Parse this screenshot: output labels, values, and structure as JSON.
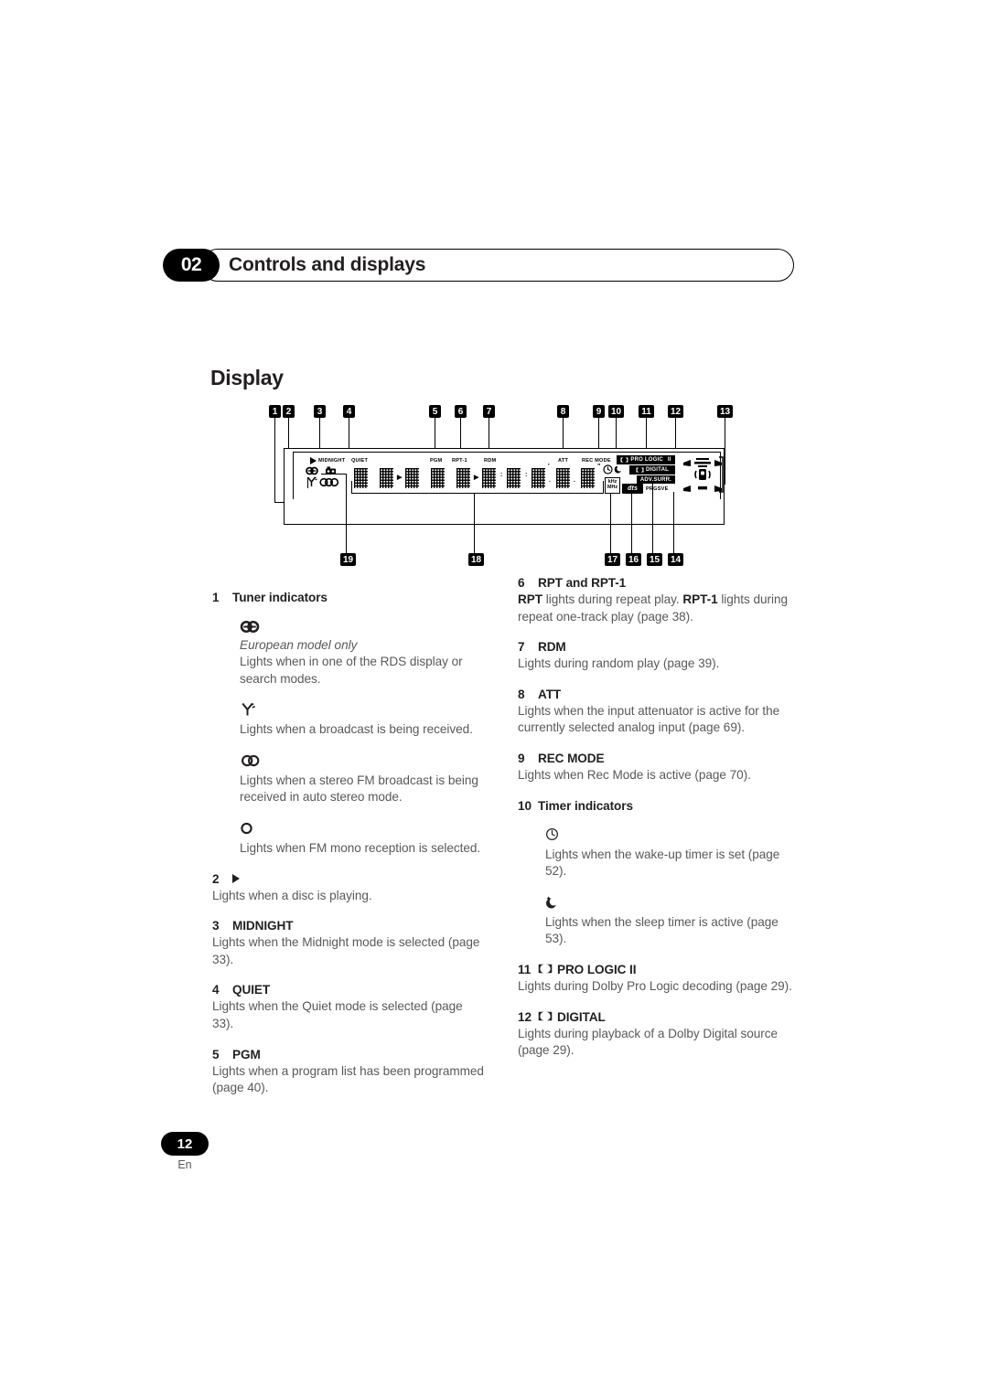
{
  "header": {
    "chapter_number": "02",
    "chapter_title": "Controls and displays"
  },
  "section": {
    "title": "Display"
  },
  "figure": {
    "callouts_top": [
      "1",
      "2",
      "3",
      "4",
      "5",
      "6",
      "7",
      "8",
      "9",
      "10",
      "11",
      "12",
      "13"
    ],
    "callouts_bottom": [
      "19",
      "18",
      "17",
      "16",
      "15",
      "14"
    ],
    "display_labels": {
      "midnight": "MIDNIGHT",
      "quiet": "QUIET",
      "pgm": "PGM",
      "rpt1": "RPT-1",
      "rdm": "RDM",
      "att": "ATT",
      "rec_mode": "REC MODE",
      "pro_logic": "PRO LOGIC",
      "pro_logic_suffix": "II",
      "digital": "DIGITAL",
      "adv_surr": "ADV.SURR.",
      "prgsve": "PRGSVE",
      "khz": "kHz",
      "mhz": "MHz",
      "dts": "dts"
    },
    "icons": [
      "play-triangle-icon",
      "rds-icon",
      "antenna-icon",
      "stereo-icon",
      "mono-icon",
      "tape-icon",
      "wake-timer-icon",
      "sleep-timer-icon",
      "speaker-layout-icon"
    ]
  },
  "left_column": [
    {
      "num": "1",
      "head": "Tuner indicators",
      "subitems": [
        {
          "icon": "rds-icon",
          "italic": "European model only",
          "desc": "Lights when in one of the RDS display or search modes."
        },
        {
          "icon": "antenna-icon",
          "desc": "Lights when a broadcast is being received."
        },
        {
          "icon": "stereo-icon",
          "desc": "Lights when a stereo FM broadcast is being received in auto stereo mode."
        },
        {
          "icon": "mono-icon",
          "desc": "Lights when FM mono reception is selected."
        }
      ]
    },
    {
      "num": "2",
      "head_icon": "play-triangle-icon",
      "head": "",
      "desc": "Lights when a disc is playing."
    },
    {
      "num": "3",
      "head": "MIDNIGHT",
      "desc": "Lights when the Midnight mode is selected (page 33)."
    },
    {
      "num": "4",
      "head": "QUIET",
      "desc": "Lights when the Quiet mode is selected (page 33)."
    },
    {
      "num": "5",
      "head": "PGM",
      "desc": "Lights when a program list has been programmed (page 40)."
    }
  ],
  "right_column": [
    {
      "num": "6",
      "head": "RPT and RPT-1",
      "desc_parts": [
        {
          "bold": true,
          "text": "RPT"
        },
        {
          "bold": false,
          "text": " lights during repeat play. "
        },
        {
          "bold": true,
          "text": "RPT-1"
        },
        {
          "bold": false,
          "text": " lights during repeat one-track play (page 38)."
        }
      ]
    },
    {
      "num": "7",
      "head": "RDM",
      "desc": "Lights during random play (page 39)."
    },
    {
      "num": "8",
      "head": "ATT",
      "desc": "Lights when the input attenuator is active for the currently selected analog input (page 69)."
    },
    {
      "num": "9",
      "head": "REC MODE",
      "desc": "Lights when Rec Mode is active (page 70)."
    },
    {
      "num": "10",
      "head": "Timer indicators",
      "subitems": [
        {
          "icon": "wake-timer-icon",
          "desc": "Lights when the wake-up timer is set (page 52)."
        },
        {
          "icon": "sleep-timer-icon",
          "desc": "Lights when the sleep timer is active (page 53)."
        }
      ]
    },
    {
      "num": "11",
      "head_prefix_icon": "dolby-double-d-icon",
      "head": "PRO LOGIC II",
      "desc": "Lights during Dolby Pro Logic decoding (page 29)."
    },
    {
      "num": "12",
      "head_prefix_icon": "dolby-double-d-icon",
      "head": "DIGITAL",
      "desc": "Lights during playback of a Dolby Digital source (page 29)."
    }
  ],
  "footer": {
    "page_number": "12",
    "language": "En"
  }
}
